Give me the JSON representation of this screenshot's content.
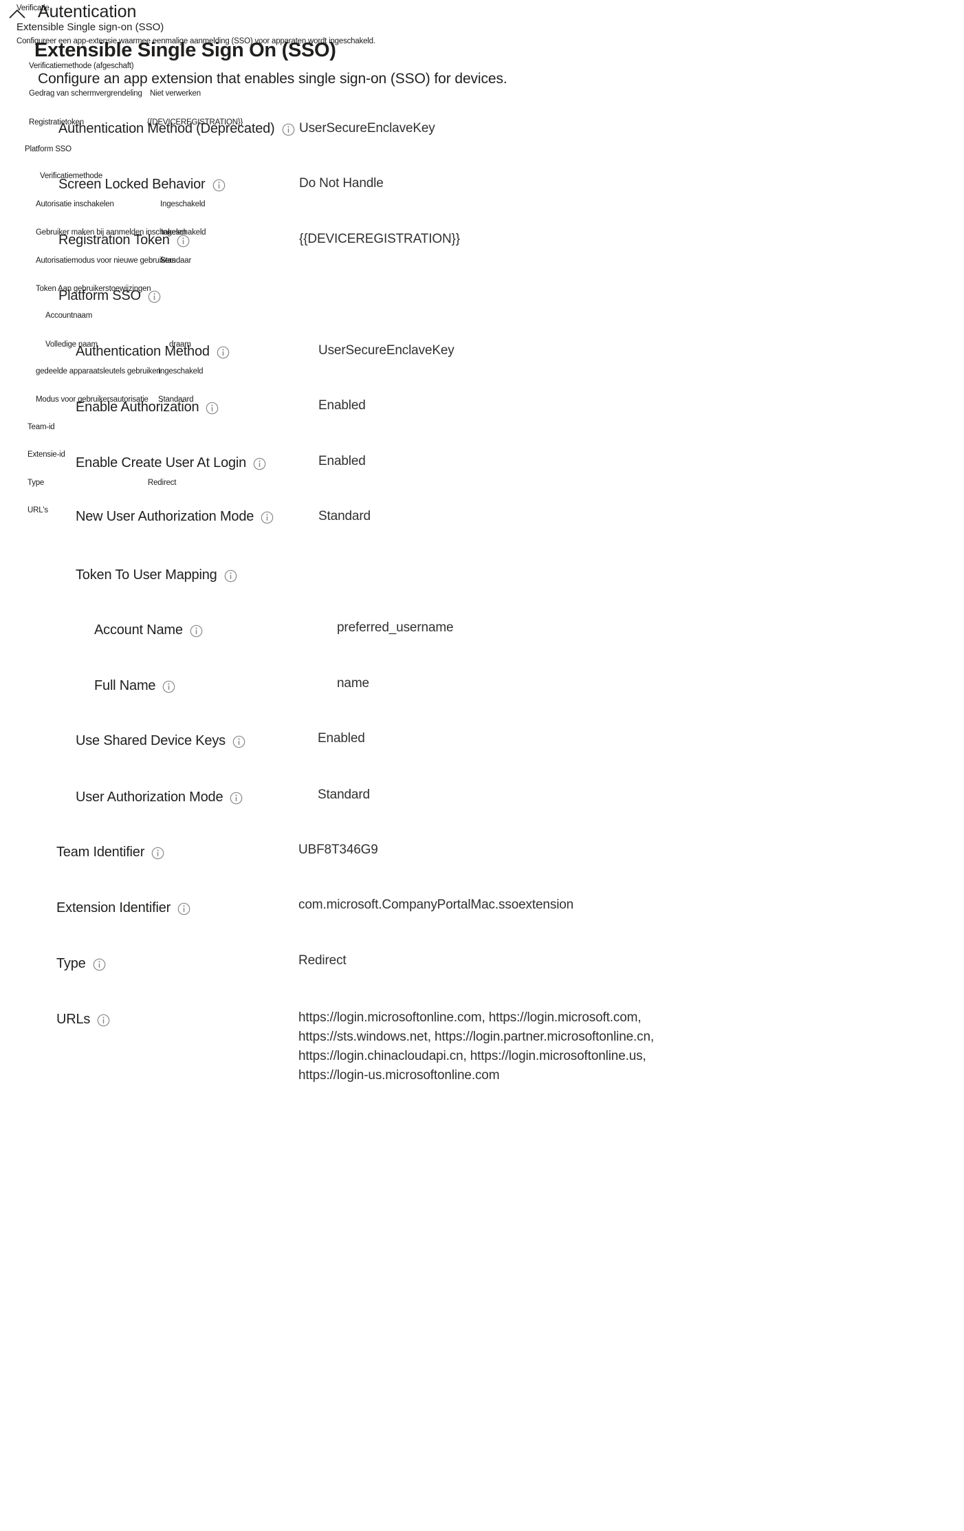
{
  "header": {
    "collapse_icon": "chevron-up-icon",
    "section_title": "Autentication",
    "breadcrumb_label": "Extensible Single sign-on (SSO)",
    "description_nl": "Configureer een app-extensie waarmee eenmalige aanmelding (SSO) voor apparaten wordt ingeschakeld.",
    "title_nl": "Verificatie",
    "big_heading": "Extensible Single Sign On (SSO)",
    "sub_heading": "Configure an app extension that enables single sign-on (SSO) for devices."
  },
  "info_icon": "info-circle-icon",
  "settings": [
    {
      "label": "Authentication Method (Deprecated)",
      "value": "UserSecureEnclaveKey"
    },
    {
      "label": "Screen Locked Behavior",
      "value": "Do Not Handle"
    },
    {
      "label": "Registration Token",
      "value": "{{DEVICEREGISTRATION}}"
    },
    {
      "label": "Platform SSO",
      "value": ""
    },
    {
      "label": "Authentication Method",
      "value": "UserSecureEnclaveKey"
    },
    {
      "label": "Enable Authorization",
      "value": "Enabled"
    },
    {
      "label": "Enable Create User At Login",
      "value": "Enabled"
    },
    {
      "label": "New User Authorization Mode",
      "value": "Standard"
    },
    {
      "label": "Token To User Mapping",
      "value": ""
    },
    {
      "label": "Account Name",
      "value": "preferred_username"
    },
    {
      "label": "Full Name",
      "value": "name"
    },
    {
      "label": "Use Shared Device Keys",
      "value": "Enabled"
    },
    {
      "label": "User Authorization Mode",
      "value": "Standard"
    },
    {
      "label": "Team Identifier",
      "value": "UBF8T346G9"
    },
    {
      "label": "Extension Identifier",
      "value": "com.microsoft.CompanyPortalMac.ssoextension"
    },
    {
      "label": "Type",
      "value": "Redirect"
    },
    {
      "label": "URLs",
      "value": "https://login.microsoftonline.com, https://login.microsoft.com, https://sts.windows.net, https://login.partner.microsoftonline.cn, https://login.chinacloudapi.cn, https://login.microsoftonline.us, https://login-us.microsoftonline.com"
    }
  ],
  "nl_settings": [
    {
      "label": "Verificatiemethode (afgeschaft)",
      "value": ""
    },
    {
      "label": "Gedrag van schermvergrendeling",
      "value": "Niet verwerken"
    },
    {
      "label": "Registratietoken",
      "value": "{{DEVICEREGISTRATION}}"
    },
    {
      "label": "Platform SSO",
      "value": ""
    },
    {
      "label": "Verificatiemethode",
      "value": ""
    },
    {
      "label": "Autorisatie inschakelen",
      "value": "Ingeschakeld"
    },
    {
      "label": "Gebruiker maken bij aanmelden inschakelen",
      "value": "Ingeschakeld"
    },
    {
      "label": "Autorisatiemodus voor nieuwe gebruikers",
      "value": "Standaar"
    },
    {
      "label": "Token Aan gebruikerstoewijzingen",
      "value": ""
    },
    {
      "label": "Accountnaam",
      "value": ""
    },
    {
      "label": "Volledige naam",
      "value": "draam"
    },
    {
      "label": "gedeelde apparaatsleutels gebruiken",
      "value": "Ingeschakeld"
    },
    {
      "label": "Modus voor gebruikersautorisatie",
      "value": "Standaard"
    },
    {
      "label": "Team-id",
      "value": ""
    },
    {
      "label": "Extensie-id",
      "value": ""
    },
    {
      "label": "Type",
      "value": "Redirect"
    },
    {
      "label": "URL's",
      "value": ""
    }
  ],
  "colors": {
    "text": "#201f1e",
    "value_text": "#323130",
    "icon_outline": "#8a8886",
    "background": "#ffffff"
  }
}
